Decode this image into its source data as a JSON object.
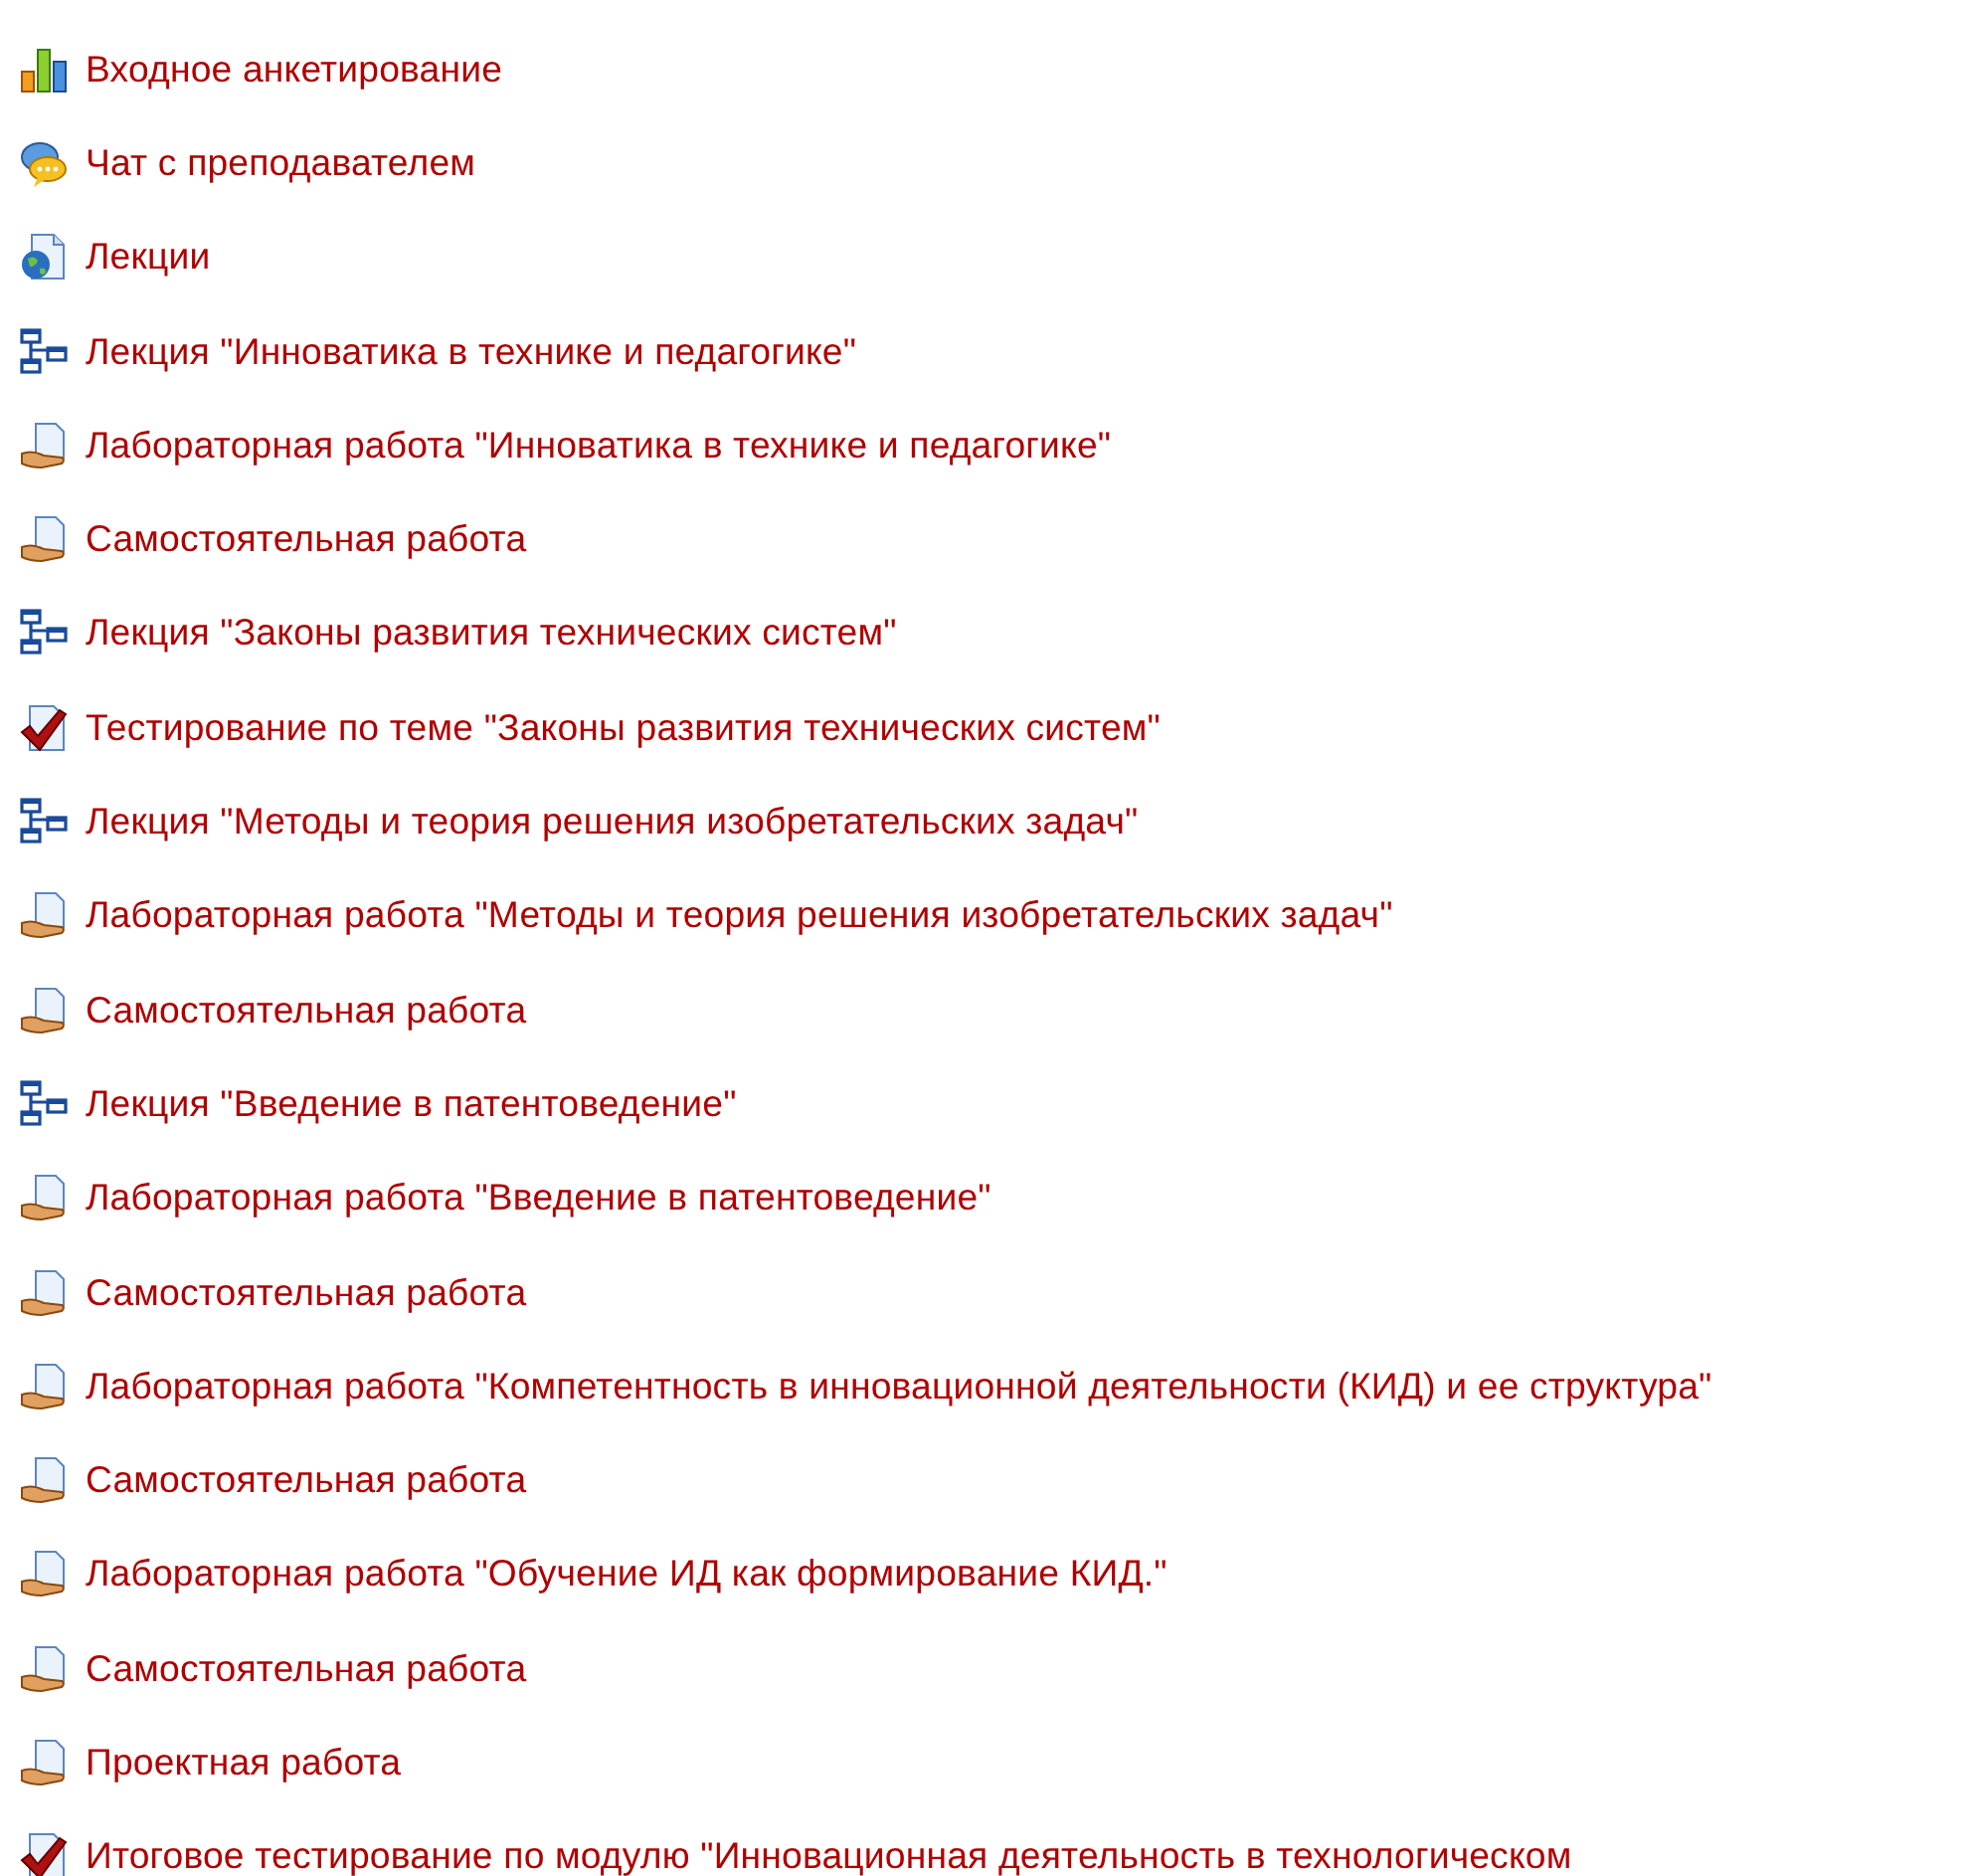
{
  "activities": [
    {
      "kind": "feedback",
      "label": "Входное анкетирование"
    },
    {
      "kind": "chat",
      "label": "Чат с преподавателем"
    },
    {
      "kind": "resource",
      "label": "Лекции"
    },
    {
      "kind": "lesson",
      "label": "Лекция \"Инноватика в технике и педагогике\""
    },
    {
      "kind": "assignment",
      "label": "Лабораторная работа \"Инноватика в технике и педагогике\""
    },
    {
      "kind": "assignment",
      "label": "Самостоятельная работа"
    },
    {
      "kind": "lesson",
      "label": "Лекция \"Законы развития технических систем\""
    },
    {
      "kind": "quiz",
      "label": "Тестирование по теме \"Законы развития технических систем\""
    },
    {
      "kind": "lesson",
      "label": "Лекция \"Методы и теория решения изобретательских задач\""
    },
    {
      "kind": "assignment",
      "label": "Лабораторная работа \"Методы и теория решения изобретательских задач\""
    },
    {
      "kind": "assignment",
      "label": "Самостоятельная работа"
    },
    {
      "kind": "lesson",
      "label": "Лекция \"Введение в патентоведение\""
    },
    {
      "kind": "assignment",
      "label": "Лабораторная работа \"Введение в патентоведение\""
    },
    {
      "kind": "assignment",
      "label": "Самостоятельная работа"
    },
    {
      "kind": "assignment",
      "label": "Лабораторная работа \"Компетентность в инновационной деятельности (КИД) и ее структура\""
    },
    {
      "kind": "assignment",
      "label": "Самостоятельная работа"
    },
    {
      "kind": "assignment",
      "label": "Лабораторная работа \"Обучение ИД как формирование КИД.\""
    },
    {
      "kind": "assignment",
      "label": "Самостоятельная работа"
    },
    {
      "kind": "assignment",
      "label": "Проектная работа"
    },
    {
      "kind": "quiz",
      "label": "Итоговое тестирование по модулю \"Инновационная деятельность в технологическом"
    }
  ]
}
